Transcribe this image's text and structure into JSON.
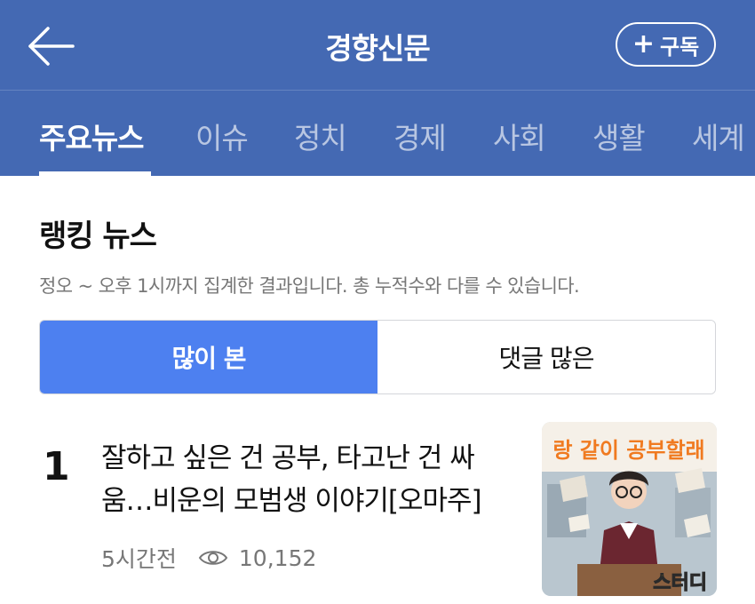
{
  "header": {
    "title": "경향신문",
    "subscribe_label": "구독",
    "icons": {
      "back": "arrow-left-icon",
      "subscribe": "plus-icon"
    }
  },
  "tabs": [
    {
      "label": "주요뉴스",
      "active": true
    },
    {
      "label": "이슈"
    },
    {
      "label": "정치"
    },
    {
      "label": "경제"
    },
    {
      "label": "사회"
    },
    {
      "label": "생활"
    },
    {
      "label": "세계"
    }
  ],
  "ranking": {
    "title": "랭킹 뉴스",
    "note": "정오 ~ 오후 1시까지 집계한 결과입니다. 총 누적수와 다를 수 있습니다.",
    "toggle": {
      "most_viewed": "많이 본",
      "most_comments": "댓글 많은",
      "selected": "많이 본"
    }
  },
  "articles": [
    {
      "rank": "1",
      "headline": "잘하고 싶은 건 공부, 타고난 건 싸움…비운의 모범생 이야기[오마주]",
      "time": "5시간전",
      "views": "10,152",
      "thumbnail": {
        "banner_text": "랑 같이 공부할래",
        "logo_text": "스터디"
      }
    }
  ],
  "colors": {
    "brand": "#4469b3",
    "accent": "#4d80f0",
    "meta": "#777777"
  }
}
